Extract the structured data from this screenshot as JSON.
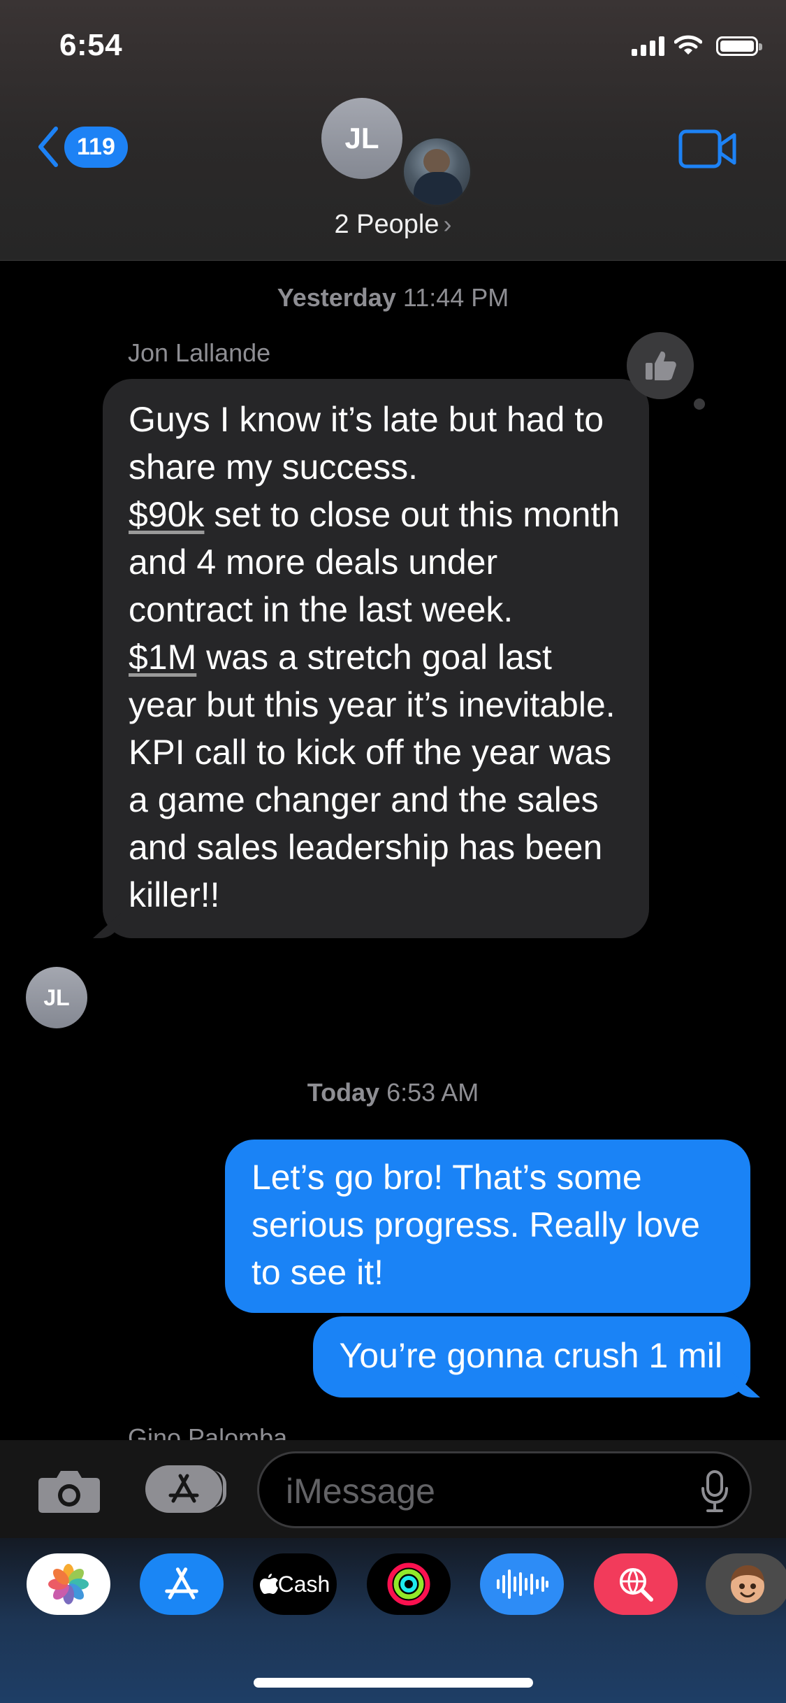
{
  "status_bar": {
    "time": "6:54"
  },
  "header": {
    "back_count": "119",
    "group_initials": "JL",
    "title": "2 People",
    "chevron": "›"
  },
  "conversation": {
    "timestamp_1": {
      "day": "Yesterday",
      "time": "11:44 PM"
    },
    "sender_1": "Jon Lallande",
    "incoming_message": {
      "line_1": "Guys I know it’s late but had to share my success.",
      "amount_1": "$90k",
      "line_2": " set to close out this month and 4 more deals under contract in the last week.",
      "amount_2": "$1M",
      "line_3": " was a stretch goal last year but this year it’s inevitable.",
      "line_4": "KPI call to kick off the year was a game changer and the sales and sales leadership has been killer!!"
    },
    "sender_1_avatar_initials": "JL",
    "timestamp_2": {
      "day": "Today",
      "time": "6:53 AM"
    },
    "outgoing_message_1": "Let’s go bro! That’s some serious progress. Really love to see it!",
    "outgoing_message_2": "You’re gonna crush 1 mil",
    "next_sender": "Gino Palomba"
  },
  "compose": {
    "placeholder": "iMessage"
  },
  "app_drawer": {
    "cash_label": "Cash"
  },
  "colors": {
    "accent_blue": "#1d82f5",
    "outgoing_bubble": "#1a83f6",
    "incoming_bubble": "#262628",
    "secondary_text": "#8e8e93"
  }
}
